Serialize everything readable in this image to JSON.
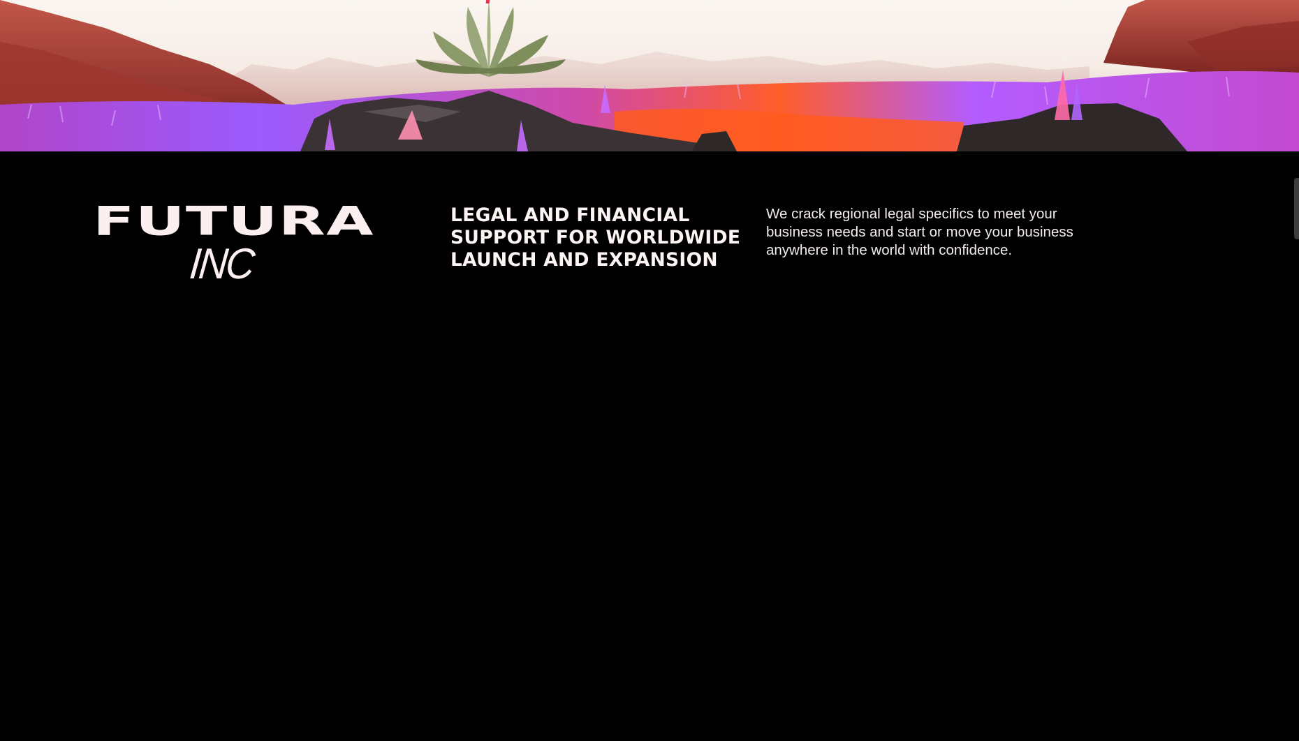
{
  "hero": {
    "image_description": "surreal landscape with violet and orange grass, red hills, rocks, crystals and an agave plant",
    "colors": {
      "sky": "#fbf6f2",
      "grass_violet": "#a45bff",
      "grass_orange": "#ff5a1f",
      "hills": "#b5463c",
      "rocks": "#3a3436"
    }
  },
  "brand": {
    "name_line1": "FUTURA",
    "name_line2": "INC"
  },
  "headline": {
    "lines": [
      "LEGAL AND FINANCIAL",
      "SUPPORT FOR WORLDWIDE",
      "LAUNCH AND EXPANSION"
    ]
  },
  "description": {
    "lines": [
      "We crack regional legal specifics to meet your",
      "business needs and start or move your business",
      "anywhere in the world with confidence."
    ]
  },
  "theme": {
    "background": "#000000",
    "text": "#fbeff0",
    "scrollbar": "#3c3c3c"
  }
}
